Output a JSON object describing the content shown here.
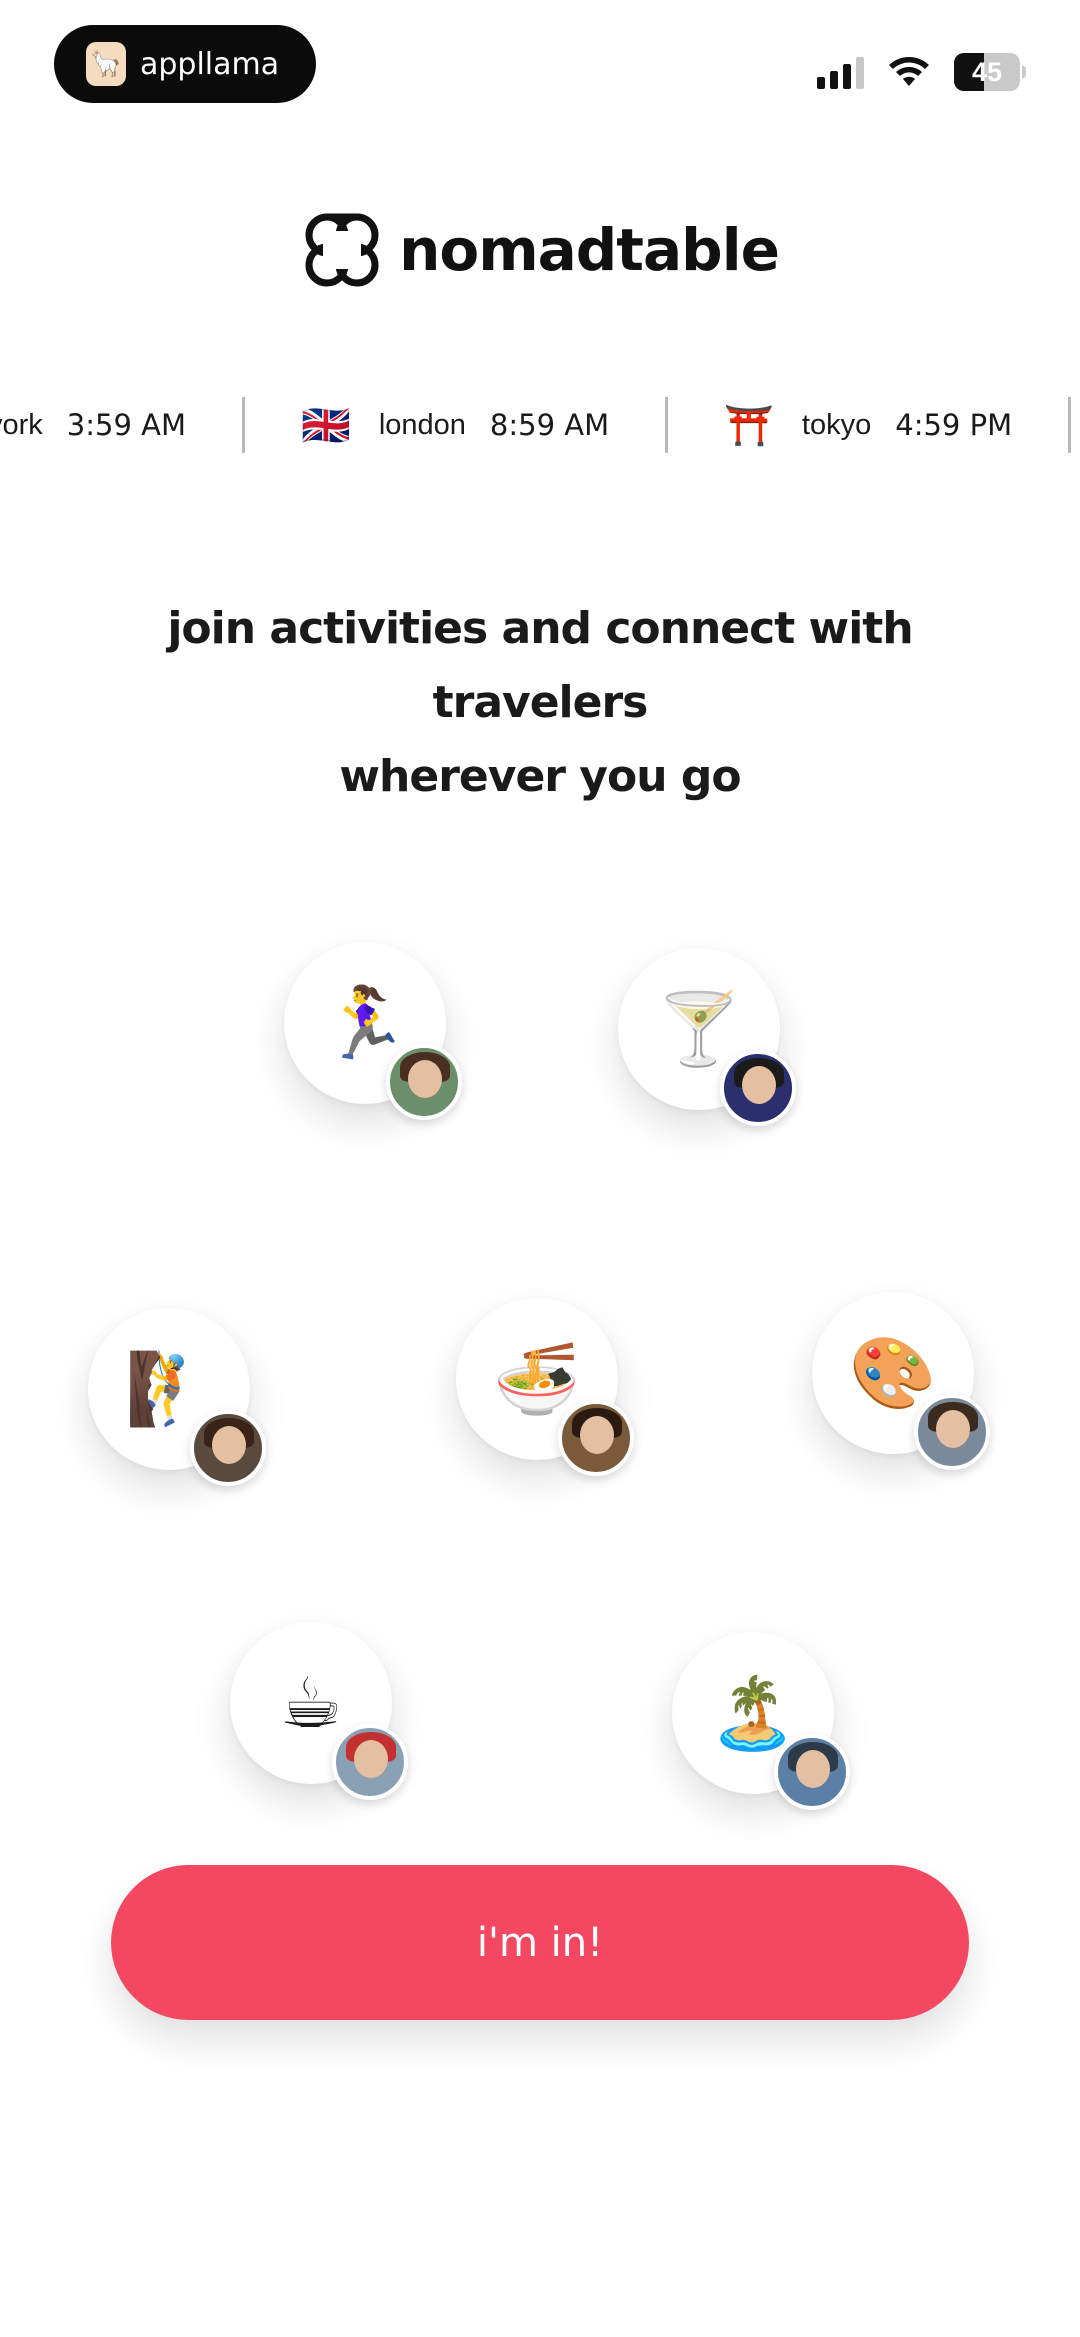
{
  "status_bar": {
    "app_pill_label": "appllama",
    "app_pill_icon": "llama-icon",
    "battery_level": "45",
    "signal_icon": "cellular-signal-icon",
    "wifi_icon": "wifi-icon"
  },
  "brand": {
    "name": "nomadtable",
    "logo_icon": "four-loop-flower-icon"
  },
  "clocks": [
    {
      "flag": "",
      "city": "york",
      "time": "3:59 AM"
    },
    {
      "flag": "🇬🇧",
      "city": "london",
      "time": "8:59 AM"
    },
    {
      "flag": "⛩️",
      "city": "tokyo",
      "time": "4:59 PM"
    }
  ],
  "headline": {
    "line1": "join activities and connect with travelers",
    "line2": "wherever you go"
  },
  "activities": [
    {
      "emoji": "🏃‍♀️",
      "name": "running",
      "avatar_bg": "#6b8f6a",
      "hair": "#4a2e1f"
    },
    {
      "emoji": "🍸",
      "name": "cocktails",
      "avatar_bg": "#2b2f6e",
      "hair": "#1b1b1b"
    },
    {
      "emoji": "🧗",
      "name": "climbing",
      "avatar_bg": "#5a4a3e",
      "hair": "#3a2418"
    },
    {
      "emoji": "🍜",
      "name": "noodles",
      "avatar_bg": "#7a5a3a",
      "hair": "#2a1a10"
    },
    {
      "emoji": "🎨",
      "name": "painting",
      "avatar_bg": "#7b8a9a",
      "hair": "#3b2a20"
    },
    {
      "emoji": "☕",
      "name": "coffee",
      "avatar_bg": "#8aa0b4",
      "hair": "#c23030"
    },
    {
      "emoji": "🏝️",
      "name": "beach",
      "avatar_bg": "#5c7fa6",
      "hair": "#2d3a4a"
    }
  ],
  "cta": {
    "label": "i'm in!",
    "color": "#f44862"
  }
}
